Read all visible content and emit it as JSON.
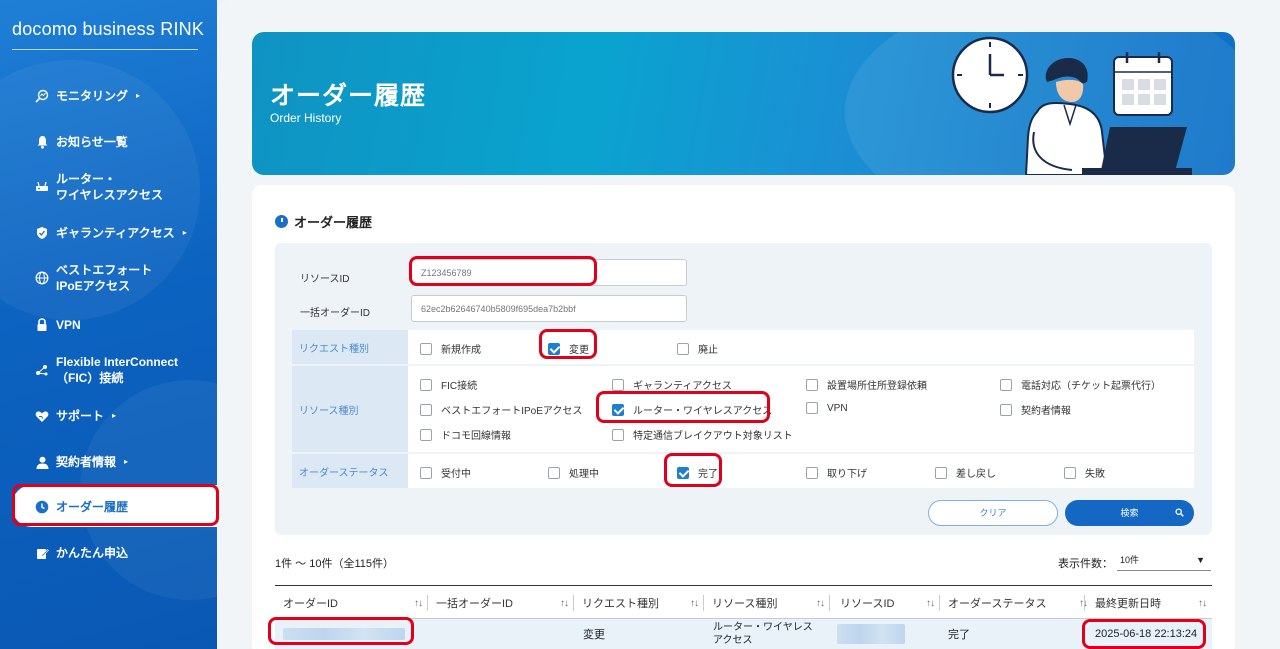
{
  "brand": "docomo business RINK",
  "sidebar": {
    "items": [
      {
        "label": "モニタリング",
        "icon": "magnify-chart-icon",
        "arrow": "▸"
      },
      {
        "label": "お知らせ一覧",
        "icon": "bell-icon"
      },
      {
        "label": "ルーター・\nワイヤレスアクセス",
        "icon": "router-icon"
      },
      {
        "label": "ギャランティアクセス",
        "icon": "shield-icon",
        "arrow": "▸"
      },
      {
        "label": "ベストエフォート\nIPoEアクセス",
        "icon": "globe-icon"
      },
      {
        "label": "VPN",
        "icon": "lock-icon"
      },
      {
        "label": "Flexible InterConnect\n（FIC）接続",
        "icon": "network-icon"
      },
      {
        "label": "サポート",
        "icon": "heart-hand-icon",
        "arrow": "▸"
      },
      {
        "label": "契約者情報",
        "icon": "person-icon",
        "arrow": "▸"
      },
      {
        "label": "オーダー履歴",
        "icon": "clock-icon"
      },
      {
        "label": "かんたん申込",
        "icon": "edit-icon"
      }
    ]
  },
  "banner": {
    "title": "オーダー履歴",
    "subtitle": "Order History"
  },
  "section_title": "オーダー履歴",
  "filter": {
    "resource_id_label": "リソースID",
    "resource_id_placeholder": "Z123456789",
    "bulk_order_label": "一括オーダーID",
    "bulk_order_placeholder": "62ec2b62646740b5809f695dea7b2bbf",
    "request_type": {
      "label": "リクエスト種別",
      "options": [
        {
          "label": "新規作成",
          "checked": false
        },
        {
          "label": "変更",
          "checked": true
        },
        {
          "label": "廃止",
          "checked": false
        }
      ]
    },
    "resource_type": {
      "label": "リソース種別",
      "options": [
        {
          "label": "FIC接続",
          "checked": false
        },
        {
          "label": "ギャランティアクセス",
          "checked": false
        },
        {
          "label": "設置場所住所登録依頼",
          "checked": false
        },
        {
          "label": "電話対応（チケット起票代行）",
          "checked": false
        },
        {
          "label": "ベストエフォートIPoEアクセス",
          "checked": false
        },
        {
          "label": "ルーター・ワイヤレスアクセス",
          "checked": true
        },
        {
          "label": "VPN",
          "checked": false
        },
        {
          "label": "契約者情報",
          "checked": false
        },
        {
          "label": "ドコモ回線情報",
          "checked": false
        },
        {
          "label": "特定通信ブレイクアウト対象リスト",
          "checked": false
        }
      ]
    },
    "order_status": {
      "label": "オーダーステータス",
      "options": [
        {
          "label": "受付中",
          "checked": false
        },
        {
          "label": "処理中",
          "checked": false
        },
        {
          "label": "完了",
          "checked": true
        },
        {
          "label": "取り下げ",
          "checked": false
        },
        {
          "label": "差し戻し",
          "checked": false
        },
        {
          "label": "失敗",
          "checked": false
        }
      ]
    },
    "clear_label": "クリア",
    "search_label": "検索"
  },
  "results": {
    "count_text": "1件 〜 10件（全115件）",
    "per_page_label": "表示件数：",
    "per_page_value": "10件",
    "columns": [
      "オーダーID",
      "一括オーダーID",
      "リクエスト種別",
      "リソース種別",
      "リソースID",
      "オーダーステータス",
      "最終更新日時"
    ],
    "sort_glyph": "↑↓",
    "rows": [
      {
        "order_id": "",
        "bulk_order_id": "",
        "request_type": "変更",
        "resource_type": "ルーター・ワイヤレス\nアクセス",
        "resource_id": "",
        "status": "完了",
        "updated": "2025-06-18 22:13:24"
      }
    ]
  }
}
